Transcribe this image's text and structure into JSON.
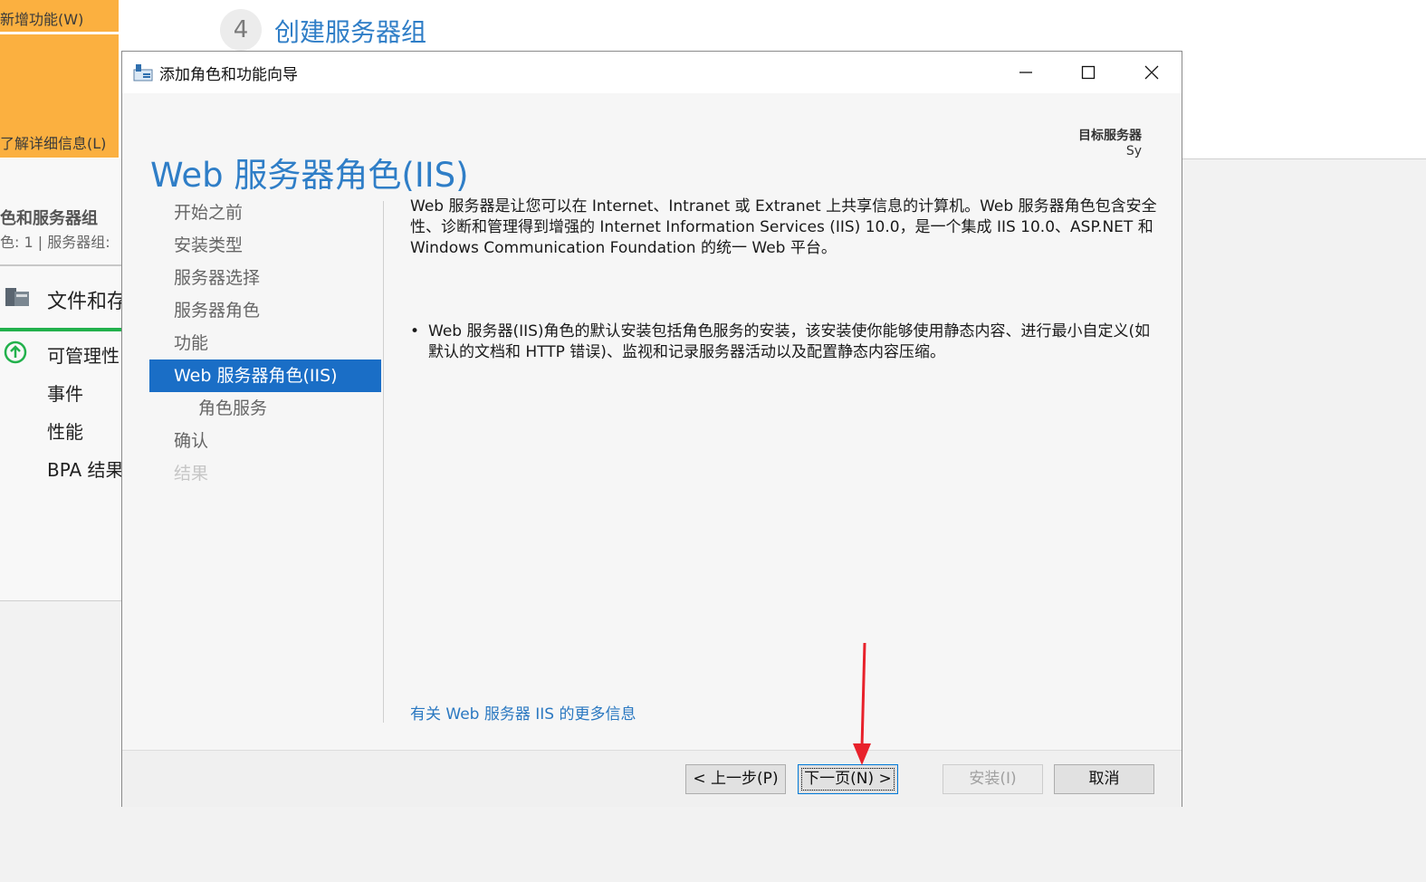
{
  "background": {
    "orange_panel": {
      "top_label": "新增功能(W)",
      "bottom_label": "了解详细信息(L)",
      "color": "#fbb040"
    },
    "step": {
      "number": "4",
      "title": "创建服务器组"
    },
    "tile": {
      "title": "色和服务器组",
      "subtitle": "色: 1 | 服务器组:",
      "name": "文件和存",
      "items": [
        "可管理性",
        "事件",
        "性能",
        "BPA 结果"
      ],
      "status_color": "#22b14c"
    }
  },
  "dialog": {
    "title": "添加角色和功能向导",
    "page_heading": "Web 服务器角色(IIS)",
    "destination": {
      "label": "目标服务器",
      "value": "Sy"
    },
    "nav": [
      {
        "label": "开始之前",
        "state": "normal"
      },
      {
        "label": "安装类型",
        "state": "normal"
      },
      {
        "label": "服务器选择",
        "state": "normal"
      },
      {
        "label": "服务器角色",
        "state": "normal"
      },
      {
        "label": "功能",
        "state": "normal"
      },
      {
        "label": "Web 服务器角色(IIS)",
        "state": "active"
      },
      {
        "label": "角色服务",
        "state": "sub"
      },
      {
        "label": "确认",
        "state": "normal"
      },
      {
        "label": "结果",
        "state": "disabled"
      }
    ],
    "description": "Web 服务器是让您可以在 Internet、Intranet 或 Extranet 上共享信息的计算机。Web 服务器角色包含安全性、诊断和管理得到增强的 Internet Information Services (IIS) 10.0，是一个集成 IIS 10.0、ASP.NET 和 Windows Communication Foundation 的统一 Web 平台。",
    "bullet": "Web 服务器(IIS)角色的默认安装包括角色服务的安装，该安装使你能够使用静态内容、进行最小自定义(如默认的文档和 HTTP 错误)、监视和记录服务器活动以及配置静态内容压缩。",
    "more_info_link": "有关 Web 服务器 IIS 的更多信息",
    "buttons": {
      "prev": "< 上一步(P)",
      "next": "下一页(N) >",
      "install": "安装(I)",
      "cancel": "取消"
    },
    "accent_color": "#1a6ec6",
    "annotation_arrow_color": "#e8212b"
  }
}
